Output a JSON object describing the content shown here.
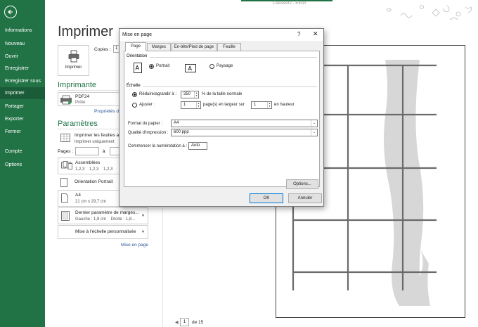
{
  "window": {
    "title": "Classeur2 - Excel",
    "accent": "#217346"
  },
  "sidebar": {
    "items": [
      {
        "label": "Informations"
      },
      {
        "label": "Nouveau"
      },
      {
        "label": "Ouvrir"
      },
      {
        "label": "Enregistrer"
      },
      {
        "label": "Enregistrer sous"
      },
      {
        "label": "Imprimer",
        "active": true
      },
      {
        "label": "Partager"
      },
      {
        "label": "Exporter"
      },
      {
        "label": "Fermer"
      },
      {
        "label": "Compte"
      },
      {
        "label": "Options"
      }
    ]
  },
  "print": {
    "title": "Imprimer",
    "button_label": "Imprimer",
    "copies_label": "Copies :",
    "copies_value": "1",
    "printer_section": "Imprimante",
    "printer_name": "PDF24",
    "printer_status": "Prête",
    "printer_properties": "Propriétés de",
    "settings_section": "Paramètres",
    "settings": {
      "what": {
        "main": "Imprimer les feuilles a",
        "sub": "Imprimer uniquement"
      },
      "pages_label": "Pages :",
      "pages_to": "à",
      "collate": {
        "main": "Assemblées",
        "sub": "1,2,3    1,2,3    1,2,3"
      },
      "orientation": {
        "main": "Orientation Portrait"
      },
      "paper": {
        "main": "A4",
        "sub": "21 cm x 29,7 cm"
      },
      "margins": {
        "main": "Dernier paramètre de marges...",
        "sub": "Gauche : 1,8 cm    Droite : 1,8..."
      },
      "scaling": {
        "main": "Mise à l'échelle personnalisée"
      }
    },
    "page_setup_link": "Mise en page"
  },
  "preview": {
    "current_page": "1",
    "of_pages": "de 15"
  },
  "dialog": {
    "title": "Mise en page",
    "help": "?",
    "close": "✕",
    "tabs": [
      {
        "label": "Page",
        "active": true
      },
      {
        "label": "Marges"
      },
      {
        "label": "En-tête/Pied de page"
      },
      {
        "label": "Feuille"
      }
    ],
    "orientation_group": "Orientation",
    "portrait_label": "Portrait",
    "landscape_label": "Paysage",
    "orientation_value": "portrait",
    "scale_group": "Échelle",
    "reduce_label": "Réduire/agrandir à :",
    "reduce_value": "350",
    "reduce_suffix": "% de la taille normale",
    "fit_label": "Ajuster :",
    "fit_wide_value": "1",
    "fit_wide_suffix": "page(s) en largeur sur",
    "fit_tall_value": "1",
    "fit_tall_suffix": "en hauteur",
    "scale_value": "reduce",
    "paper_size_label": "Format du papier :",
    "paper_size_value": "A4",
    "print_quality_label": "Qualité d'impression :",
    "print_quality_value": "600 ppp",
    "first_page_label": "Commencer la numérotation à :",
    "first_page_value": "Auto",
    "options_button": "Options...",
    "ok_button": "OK",
    "cancel_button": "Annuler"
  }
}
